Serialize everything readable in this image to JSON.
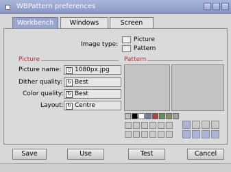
{
  "window": {
    "title": "WBPattern preferences"
  },
  "tabs": [
    {
      "label": "Workbench",
      "active": true
    },
    {
      "label": "Windows",
      "active": false
    },
    {
      "label": "Screen",
      "active": false
    }
  ],
  "image_type": {
    "label": "Image type:",
    "options": [
      "Picture",
      "Pattern"
    ]
  },
  "picture": {
    "section_label": "Picture",
    "name_label": "Picture name:",
    "name_value": "1080px.jpg",
    "dither_label": "Dither quality:",
    "dither_value": "Best",
    "color_label": "Color quality:",
    "color_value": "Best",
    "layout_label": "Layout:",
    "layout_value": "Centre"
  },
  "pattern": {
    "section_label": "Pattern"
  },
  "palette_colors": [
    "#bfbfbf",
    "#000000",
    "#ffffff",
    "#6f7fa0",
    "#b04040",
    "#5f8f5f",
    "#909060",
    "#a0a0a0"
  ],
  "buttons": {
    "save": "Save",
    "use": "Use",
    "test": "Test",
    "cancel": "Cancel"
  }
}
